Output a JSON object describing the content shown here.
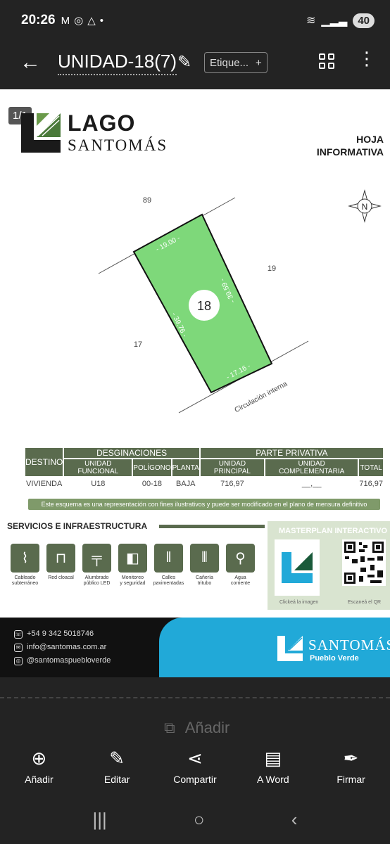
{
  "status": {
    "time": "20:26",
    "battery": "40"
  },
  "appbar": {
    "title": "UNIDAD-18(7)",
    "tag_label": "Etique..."
  },
  "doc": {
    "page_indicator": "1/1",
    "brand_line1": "LAGO",
    "brand_line2": "SANTOMÁS",
    "info_line1": "HOJA",
    "info_line2": "INFORMATIVA",
    "plan": {
      "lot_number": "18",
      "neighbor_top": "89",
      "neighbor_right": "19",
      "neighbor_left": "17",
      "dim_top": "- 19.00 -",
      "dim_right": "- 39.59 -",
      "dim_left": "- 39.76 -",
      "dim_bottom": "- 17.16 -",
      "street": "Circulación interna",
      "north": "N"
    },
    "table": {
      "destino_header": "DESTINO",
      "designaciones_header": "DESGINACIONES",
      "parte_header": "PARTE PRIVATIVA",
      "sub_unidad_funcional": "UNIDAD FUNCIONAL",
      "sub_poligono": "POLÍGONO",
      "sub_planta": "PLANTA",
      "sub_unidad_principal": "UNIDAD PRINCIPAL",
      "sub_unidad_complementaria": "UNIDAD COMPLEMENTARIA",
      "sub_total": "TOTAL",
      "row": {
        "destino": "VIVIENDA",
        "unidad_funcional": "U18",
        "poligono": "00-18",
        "planta": "BAJA",
        "principal": "716,97",
        "complementaria": "__,__",
        "total": "716,97"
      }
    },
    "disclaimer": "Este esquema es una representación con fines ilustrativos y puede ser modificado en el plano de mensura definitivo",
    "services_title": "SERVICIOS E INFRAESTRUCTURA",
    "services": [
      {
        "label1": "Cableado",
        "label2": "subterráneo"
      },
      {
        "label1": "Red cloacal",
        "label2": ""
      },
      {
        "label1": "Alumbrado",
        "label2": "público LED"
      },
      {
        "label1": "Monitoreo",
        "label2": "y seguridad"
      },
      {
        "label1": "Calles",
        "label2": "pavimentadas"
      },
      {
        "label1": "Cañería",
        "label2": "tritubo"
      },
      {
        "label1": "Agua",
        "label2": "corriente"
      }
    ],
    "masterplan": {
      "title": "MASTERPLAN INTERACTIVO",
      "caption_image": "Clickeá la imagen",
      "caption_qr": "Escaneá el QR"
    },
    "footer": {
      "phone": "+54 9 342 5018746",
      "email": "info@santomas.com.ar",
      "instagram": "@santomaspuebloverde",
      "logo_name": "SANTOMÁS",
      "logo_sub": "Pueblo Verde"
    }
  },
  "add_hint": "Añadir",
  "toolbar": [
    {
      "label": "Añadir"
    },
    {
      "label": "Editar"
    },
    {
      "label": "Compartir"
    },
    {
      "label": "A Word"
    },
    {
      "label": "Firmar"
    }
  ],
  "colors": {
    "lot_fill": "#7ed87a",
    "brand_green": "#5a6b4e",
    "brand_blue": "#21a9d8"
  }
}
